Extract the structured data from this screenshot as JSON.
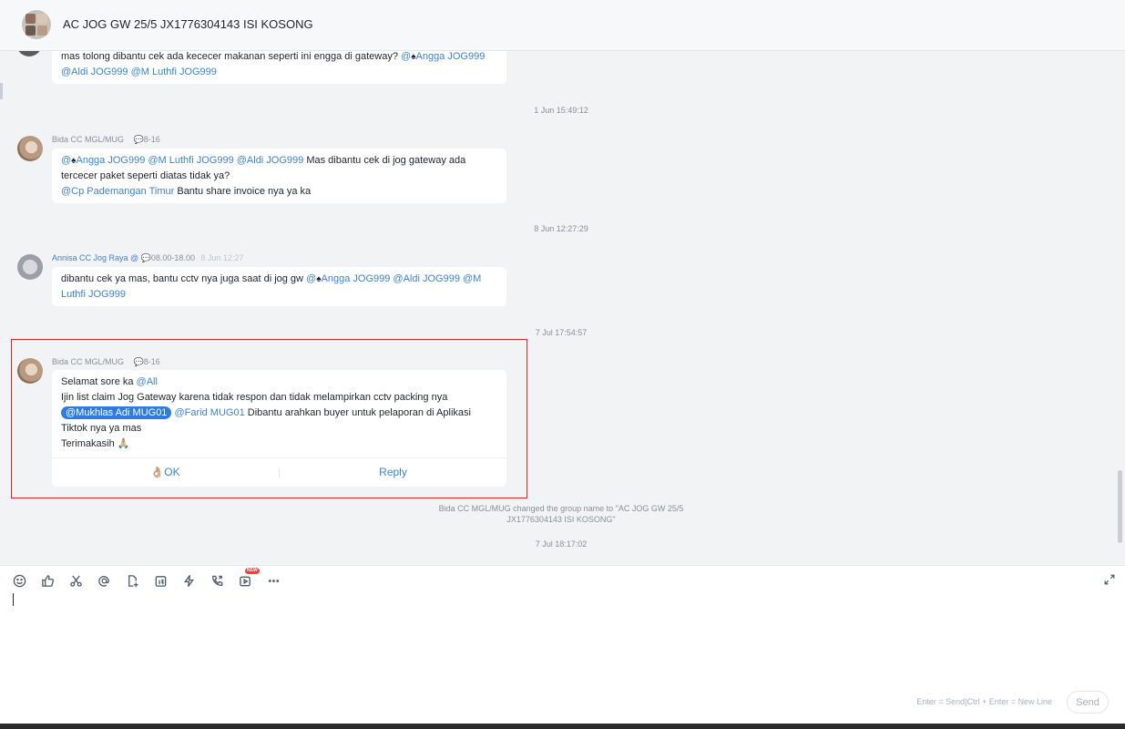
{
  "header": {
    "title": "AC JOG GW 25/5 JX1776304143 ISI KOSONG"
  },
  "messages": [
    {
      "id": "m0",
      "parts": [
        {
          "text": "mas tolong dibantu cek ada kececer makanan seperti ini engga di gateway? "
        },
        {
          "text": "@",
          "mention": true
        },
        {
          "text": "♠",
          "icon": true
        },
        {
          "text": "Angga JOG999",
          "mention": true
        },
        {
          "text": " "
        },
        {
          "text": "@Aldi JOG999",
          "mention": true
        },
        {
          "text": " "
        },
        {
          "text": "@M Luthfi JOG999",
          "mention": true
        }
      ]
    },
    {
      "id": "m1",
      "sender": "Bida CC MGL/MUG",
      "meta": "💬8-16",
      "parts": [
        {
          "text": "@",
          "mention": true
        },
        {
          "text": "♠",
          "icon": true
        },
        {
          "text": "Angga JOG999 @M Luthfi JOG999 @Aldi JOG999",
          "mention": true
        },
        {
          "text": " Mas dibantu cek di jog gateway ada tercecer paket seperti diatas tidak ya?"
        },
        {
          "br": true
        },
        {
          "text": "@Cp Pademangan Timur",
          "mention": true
        },
        {
          "text": " Bantu share invoice nya ya ka"
        }
      ]
    },
    {
      "id": "m2",
      "sender": "Annisa CC Jog Raya @",
      "meta": "💬08.00-18.00",
      "meta_time": "8 Jun 12:27",
      "parts": [
        {
          "text": "dibantu cek ya mas, bantu cctv nya juga saat di jog gw "
        },
        {
          "text": "@",
          "mention": true
        },
        {
          "text": "♠",
          "icon": true
        },
        {
          "text": "Angga JOG999 @Aldi JOG999 @M Luthfi JOG999",
          "mention": true
        }
      ]
    },
    {
      "id": "m3",
      "sender": "Bida CC MGL/MUG",
      "meta": "💬8-16",
      "parts": [
        {
          "text": "Selamat sore ka "
        },
        {
          "text": "@All",
          "mention": true
        },
        {
          "br": true
        },
        {
          "text": "Ijin list claim Jog Gateway karena tidak respon dan tidak melampirkan cctv packing nya"
        },
        {
          "br": true
        },
        {
          "text": "@Mukhlas Adi MUG01",
          "pill": true
        },
        {
          "text": " "
        },
        {
          "text": "@Farid MUG01",
          "mention": true
        },
        {
          "text": " Dibantu arahkan buyer untuk pelaporan di Aplikasi Tiktok nya ya mas"
        },
        {
          "br": true
        },
        {
          "text": "Terimakasih 🙏🏼"
        }
      ],
      "actions": {
        "ok": "👌🏼OK",
        "reply": "Reply"
      }
    }
  ],
  "timestamps": {
    "t1": "1 Jun 15:49:12",
    "t2": "8 Jun 12:27:29",
    "t3": "7 Jul 17:54:57",
    "t4": "7 Jul 18:17:02"
  },
  "system_note": "Bida CC MGL/MUG changed the group name to \"AC JOG GW 25/5 JX1776304143 ISI KOSONG\"",
  "toolbar": {
    "icons": [
      "smile-icon",
      "thumbs-up-icon",
      "scissors-icon",
      "at-icon",
      "file-add-icon",
      "calendar-icon",
      "flash-icon",
      "phone-icon",
      "video-icon",
      "more-icon"
    ],
    "new_badge": "NEW"
  },
  "composer": {
    "hint": "Enter = Send|Ctrl + Enter = New Line",
    "send_label": "Send",
    "value": ""
  }
}
